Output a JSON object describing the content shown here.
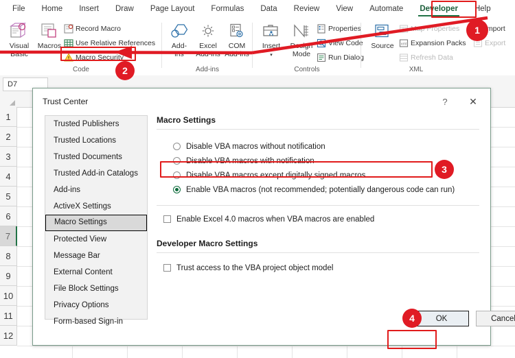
{
  "colors": {
    "accent_green": "#217346",
    "annotation_red": "#e01b24",
    "selected_radio": "#0b6a3a"
  },
  "ribbon": {
    "tabs": [
      {
        "label": "File",
        "active": false
      },
      {
        "label": "Home",
        "active": false
      },
      {
        "label": "Insert",
        "active": false
      },
      {
        "label": "Draw",
        "active": false
      },
      {
        "label": "Page Layout",
        "active": false
      },
      {
        "label": "Formulas",
        "active": false
      },
      {
        "label": "Data",
        "active": false
      },
      {
        "label": "Review",
        "active": false
      },
      {
        "label": "View",
        "active": false
      },
      {
        "label": "Automate",
        "active": false
      },
      {
        "label": "Developer",
        "active": true
      },
      {
        "label": "Help",
        "active": false
      }
    ],
    "groups": [
      {
        "name": "Code",
        "label": "Code"
      },
      {
        "name": "Add-ins",
        "label": "Add-ins"
      },
      {
        "name": "Controls",
        "label": "Controls"
      },
      {
        "name": "XML",
        "label": "XML"
      }
    ],
    "code_group": {
      "visual_basic": "Visual\nBasic",
      "visual_basic_line1": "Visual",
      "visual_basic_line2": "Basic",
      "macros": "Macros",
      "record_macro": "Record Macro",
      "use_relative_references": "Use Relative References",
      "macro_security": "Macro Security"
    },
    "addins_group": {
      "add_ins_line1": "Add-",
      "add_ins_line2": "ins",
      "excel_line1": "Excel",
      "excel_line2": "Add-ins",
      "com_line1": "COM",
      "com_line2": "Add-ins"
    },
    "controls_group": {
      "insert": "Insert",
      "design_line1": "Design",
      "design_line2": "Mode",
      "properties": "Properties",
      "view_code": "View Code",
      "run_dialog": "Run Dialog"
    },
    "xml_group": {
      "source": "Source",
      "map_properties": "Map Properties",
      "expansion_packs": "Expansion Packs",
      "refresh_data": "Refresh Data",
      "import": "Import",
      "export": "Export"
    }
  },
  "formula_bar": {
    "name_box_value": "D7"
  },
  "sheet": {
    "row_headers": [
      "1",
      "2",
      "3",
      "4",
      "5",
      "6",
      "7",
      "8",
      "9",
      "10",
      "11",
      "12"
    ],
    "selected_row": "7"
  },
  "dialog": {
    "title": "Trust Center",
    "help_icon": "?",
    "close_icon": "✕",
    "nav_items": [
      {
        "label": "Trusted Publishers",
        "selected": false
      },
      {
        "label": "Trusted Locations",
        "selected": false
      },
      {
        "label": "Trusted Documents",
        "selected": false
      },
      {
        "label": "Trusted Add-in Catalogs",
        "selected": false
      },
      {
        "label": "Add-ins",
        "selected": false
      },
      {
        "label": "ActiveX Settings",
        "selected": false
      },
      {
        "label": "Macro Settings",
        "selected": true
      },
      {
        "label": "Protected View",
        "selected": false
      },
      {
        "label": "Message Bar",
        "selected": false
      },
      {
        "label": "External Content",
        "selected": false
      },
      {
        "label": "File Block Settings",
        "selected": false
      },
      {
        "label": "Privacy Options",
        "selected": false
      },
      {
        "label": "Form-based Sign-in",
        "selected": false
      }
    ],
    "macro_settings": {
      "heading": "Macro Settings",
      "options": [
        {
          "label": "Disable VBA macros without notification",
          "checked": false
        },
        {
          "label": "Disable VBA macros with notification",
          "checked": false
        },
        {
          "label": "Disable VBA macros except digitally signed macros",
          "checked": false
        },
        {
          "label": "Enable VBA macros (not recommended; potentially dangerous code can run)",
          "checked": true
        }
      ],
      "excel4_checkbox": {
        "label": "Enable Excel 4.0 macros when VBA macros are enabled",
        "checked": false
      }
    },
    "developer_macro_settings": {
      "heading": "Developer Macro Settings",
      "trust_access_checkbox": {
        "label": "Trust access to the VBA project object model",
        "checked": false
      }
    },
    "buttons": {
      "ok": "OK",
      "cancel": "Cancel"
    }
  },
  "annotations": {
    "badges": [
      {
        "number": "1"
      },
      {
        "number": "2"
      },
      {
        "number": "3"
      },
      {
        "number": "4"
      }
    ]
  }
}
